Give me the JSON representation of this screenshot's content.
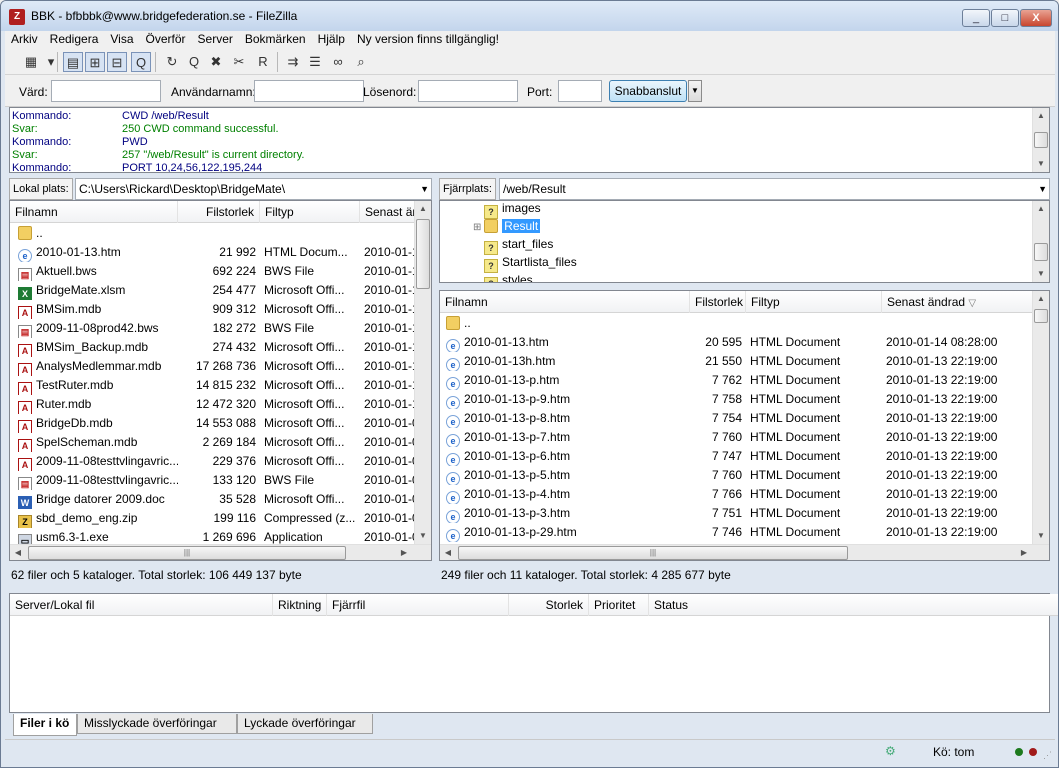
{
  "window": {
    "title": "BBK - bfbbbk@www.bridgefederation.se - FileZilla",
    "app_icon": "filezilla-icon",
    "controls": {
      "minimize": "_",
      "maximize": "□",
      "close": "X"
    }
  },
  "menu": [
    "Arkiv",
    "Redigera",
    "Visa",
    "Överför",
    "Server",
    "Bokmärken",
    "Hjälp",
    "Ny version finns tillgänglig!"
  ],
  "toolbar": {
    "buttons": [
      {
        "name": "site-manager-icon",
        "glyph": "▦"
      },
      {
        "name": "dropdown-arrow-icon",
        "glyph": "▾"
      },
      {
        "name": "toggle-log-icon",
        "glyph": "▤"
      },
      {
        "name": "toggle-local-tree-icon",
        "glyph": "⊞"
      },
      {
        "name": "toggle-remote-tree-icon",
        "glyph": "⊟"
      },
      {
        "name": "toggle-queue-icon",
        "glyph": "Q"
      },
      {
        "name": "refresh-icon",
        "glyph": "↻"
      },
      {
        "name": "process-queue-icon",
        "glyph": "Q"
      },
      {
        "name": "cancel-icon",
        "glyph": "✖"
      },
      {
        "name": "disconnect-icon",
        "glyph": "✂"
      },
      {
        "name": "reconnect-icon",
        "glyph": "R"
      },
      {
        "name": "filter-icon",
        "glyph": "⇉"
      },
      {
        "name": "compare-icon",
        "glyph": "☰"
      },
      {
        "name": "sync-browse-icon",
        "glyph": "∞"
      },
      {
        "name": "search-icon",
        "glyph": "⌕"
      }
    ]
  },
  "quickconnect": {
    "host_label": "Värd:",
    "user_label": "Användarnamn:",
    "pass_label": "Lösenord:",
    "port_label": "Port:",
    "host_value": "",
    "user_value": "",
    "pass_value": "",
    "port_value": "",
    "button": "Snabbanslut",
    "arrow": "▼"
  },
  "log": [
    {
      "k": "Kommando:",
      "v": "CWD /web/Result",
      "c": "#000080"
    },
    {
      "k": "Svar:",
      "v": "250 CWD command successful.",
      "c": "#008000"
    },
    {
      "k": "Kommando:",
      "v": "PWD",
      "c": "#000080"
    },
    {
      "k": "Svar:",
      "v": "257 \"/web/Result\" is current directory.",
      "c": "#008000"
    },
    {
      "k": "Kommando:",
      "v": "PORT 10,24,56,122,195,244",
      "c": "#000080"
    }
  ],
  "local": {
    "path_label": "Lokal plats:",
    "path": "C:\\Users\\Rickard\\Desktop\\BridgeMate\\",
    "columns": [
      "Filnamn",
      "Filstorlek",
      "Filtyp",
      "Senast än"
    ],
    "rows": [
      {
        "icon": "folder",
        "name": "..",
        "size": "",
        "type": "",
        "date": ""
      },
      {
        "icon": "ie",
        "name": "2010-01-13.htm",
        "size": "21 992",
        "type": "HTML Docum...",
        "date": "2010-01-1"
      },
      {
        "icon": "bws",
        "name": "Aktuell.bws",
        "size": "692 224",
        "type": "BWS File",
        "date": "2010-01-1"
      },
      {
        "icon": "xls",
        "name": "BridgeMate.xlsm",
        "size": "254 477",
        "type": "Microsoft Offi...",
        "date": "2010-01-1"
      },
      {
        "icon": "mdb",
        "name": "BMSim.mdb",
        "size": "909 312",
        "type": "Microsoft Offi...",
        "date": "2010-01-1"
      },
      {
        "icon": "bws",
        "name": "2009-11-08prod42.bws",
        "size": "182 272",
        "type": "BWS File",
        "date": "2010-01-1"
      },
      {
        "icon": "mdb",
        "name": "BMSim_Backup.mdb",
        "size": "274 432",
        "type": "Microsoft Offi...",
        "date": "2010-01-1"
      },
      {
        "icon": "mdb",
        "name": "AnalysMedlemmar.mdb",
        "size": "17 268 736",
        "type": "Microsoft Offi...",
        "date": "2010-01-1"
      },
      {
        "icon": "mdb",
        "name": "TestRuter.mdb",
        "size": "14 815 232",
        "type": "Microsoft Offi...",
        "date": "2010-01-1"
      },
      {
        "icon": "mdb",
        "name": "Ruter.mdb",
        "size": "12 472 320",
        "type": "Microsoft Offi...",
        "date": "2010-01-1"
      },
      {
        "icon": "mdb",
        "name": "BridgeDb.mdb",
        "size": "14 553 088",
        "type": "Microsoft Offi...",
        "date": "2010-01-0"
      },
      {
        "icon": "mdb",
        "name": "SpelScheman.mdb",
        "size": "2 269 184",
        "type": "Microsoft Offi...",
        "date": "2010-01-0"
      },
      {
        "icon": "mdb",
        "name": "2009-11-08testtvlingavric...",
        "size": "229 376",
        "type": "Microsoft Offi...",
        "date": "2010-01-0"
      },
      {
        "icon": "bws",
        "name": "2009-11-08testtvlingavric...",
        "size": "133 120",
        "type": "BWS File",
        "date": "2010-01-0"
      },
      {
        "icon": "doc",
        "name": "Bridge datorer 2009.doc",
        "size": "35 528",
        "type": "Microsoft Offi...",
        "date": "2010-01-0"
      },
      {
        "icon": "zip",
        "name": "sbd_demo_eng.zip",
        "size": "199 116",
        "type": "Compressed (z...",
        "date": "2010-01-0"
      },
      {
        "icon": "exe",
        "name": "usm6.3-1.exe",
        "size": "1 269 696",
        "type": "Application",
        "date": "2010-01-0"
      }
    ],
    "status": "62 filer och 5 kataloger. Total storlek: 106 449 137 byte"
  },
  "remote": {
    "path_label": "Fjärrplats:",
    "path": "/web/Result",
    "tree": [
      {
        "name": "images",
        "icon": "q",
        "selected": false
      },
      {
        "name": "Result",
        "icon": "folder",
        "selected": true
      },
      {
        "name": "start_files",
        "icon": "q",
        "selected": false
      },
      {
        "name": "Startlista_files",
        "icon": "q",
        "selected": false
      },
      {
        "name": "styles",
        "icon": "q",
        "selected": false
      }
    ],
    "columns": [
      "Filnamn",
      "Filstorlek",
      "Filtyp",
      "Senast ändrad"
    ],
    "rows": [
      {
        "icon": "folder",
        "name": "..",
        "size": "",
        "type": "",
        "date": ""
      },
      {
        "icon": "ie",
        "name": "2010-01-13.htm",
        "size": "20 595",
        "type": "HTML Document",
        "date": "2010-01-14 08:28:00"
      },
      {
        "icon": "ie",
        "name": "2010-01-13h.htm",
        "size": "21 550",
        "type": "HTML Document",
        "date": "2010-01-13 22:19:00"
      },
      {
        "icon": "ie",
        "name": "2010-01-13-p.htm",
        "size": "7 762",
        "type": "HTML Document",
        "date": "2010-01-13 22:19:00"
      },
      {
        "icon": "ie",
        "name": "2010-01-13-p-9.htm",
        "size": "7 758",
        "type": "HTML Document",
        "date": "2010-01-13 22:19:00"
      },
      {
        "icon": "ie",
        "name": "2010-01-13-p-8.htm",
        "size": "7 754",
        "type": "HTML Document",
        "date": "2010-01-13 22:19:00"
      },
      {
        "icon": "ie",
        "name": "2010-01-13-p-7.htm",
        "size": "7 760",
        "type": "HTML Document",
        "date": "2010-01-13 22:19:00"
      },
      {
        "icon": "ie",
        "name": "2010-01-13-p-6.htm",
        "size": "7 747",
        "type": "HTML Document",
        "date": "2010-01-13 22:19:00"
      },
      {
        "icon": "ie",
        "name": "2010-01-13-p-5.htm",
        "size": "7 760",
        "type": "HTML Document",
        "date": "2010-01-13 22:19:00"
      },
      {
        "icon": "ie",
        "name": "2010-01-13-p-4.htm",
        "size": "7 766",
        "type": "HTML Document",
        "date": "2010-01-13 22:19:00"
      },
      {
        "icon": "ie",
        "name": "2010-01-13-p-3.htm",
        "size": "7 751",
        "type": "HTML Document",
        "date": "2010-01-13 22:19:00"
      },
      {
        "icon": "ie",
        "name": "2010-01-13-p-29.htm",
        "size": "7 746",
        "type": "HTML Document",
        "date": "2010-01-13 22:19:00"
      }
    ],
    "status": "249 filer och 11 kataloger. Total storlek: 4 285 677 byte"
  },
  "queue": {
    "columns": [
      "Server/Lokal fil",
      "Riktning",
      "Fjärrfil",
      "Storlek",
      "Prioritet",
      "Status"
    ],
    "tabs": [
      "Filer i kö",
      "Misslyckade överföringar",
      "Lyckade överföringar"
    ]
  },
  "statusbar": {
    "queue": "Kö: tom",
    "icon": "queue-status-icon",
    "indicator_colors": [
      "#1d7a1d",
      "#a11a1a"
    ]
  }
}
